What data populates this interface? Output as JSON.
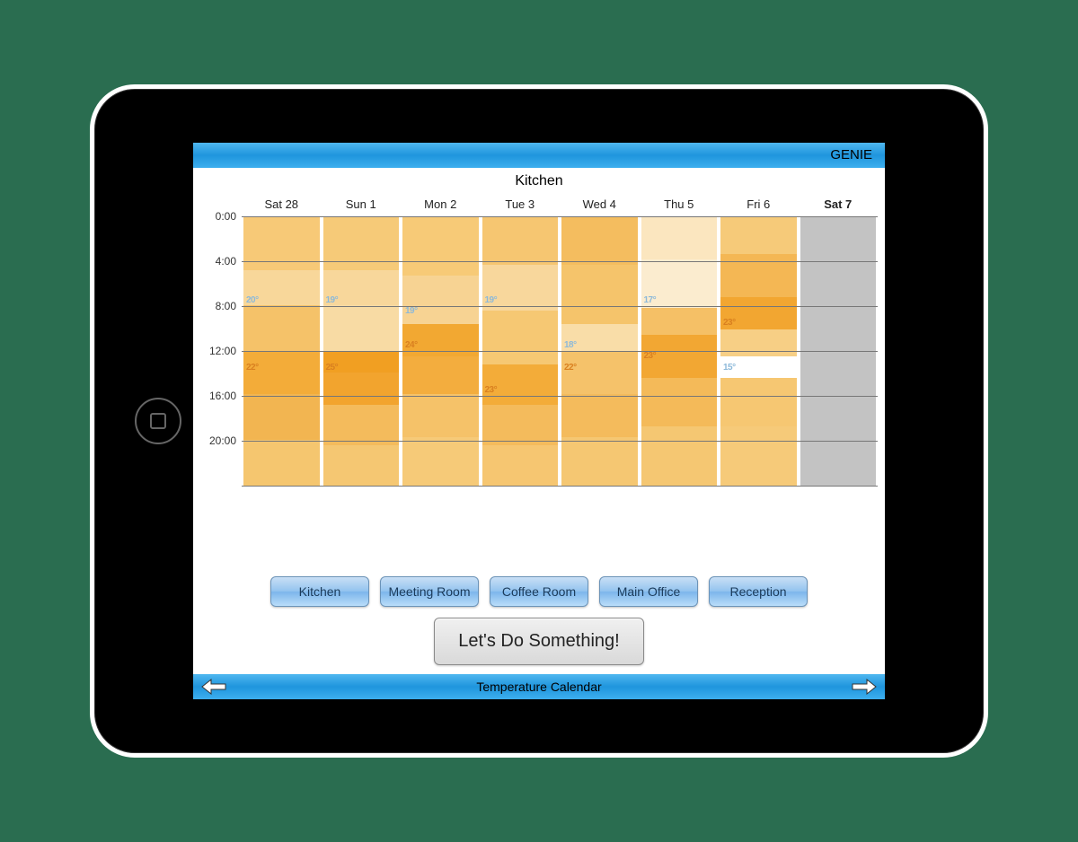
{
  "header": {
    "brand": "GENIE"
  },
  "page_title": "Kitchen",
  "footer": {
    "title": "Temperature Calendar"
  },
  "time_labels": [
    "0:00",
    "4:00",
    "8:00",
    "12:00",
    "16:00",
    "20:00"
  ],
  "days": [
    {
      "label": "Sat 28",
      "bold": false,
      "future": false
    },
    {
      "label": "Sun 1",
      "bold": false,
      "future": false
    },
    {
      "label": "Mon 2",
      "bold": false,
      "future": false
    },
    {
      "label": "Tue 3",
      "bold": false,
      "future": false
    },
    {
      "label": "Wed 4",
      "bold": false,
      "future": false
    },
    {
      "label": "Thu 5",
      "bold": false,
      "future": false
    },
    {
      "label": "Fri 6",
      "bold": false,
      "future": false
    },
    {
      "label": "Sat 7",
      "bold": true,
      "future": true
    }
  ],
  "annotations": [
    {
      "day": 0,
      "hour": 7,
      "text": "20°",
      "style": "cool"
    },
    {
      "day": 0,
      "hour": 13,
      "text": "22°",
      "style": "warm"
    },
    {
      "day": 1,
      "hour": 7,
      "text": "19°",
      "style": "cool"
    },
    {
      "day": 1,
      "hour": 13,
      "text": "25°",
      "style": "warm"
    },
    {
      "day": 2,
      "hour": 8,
      "text": "19°",
      "style": "cool"
    },
    {
      "day": 2,
      "hour": 11,
      "text": "24°",
      "style": "warm"
    },
    {
      "day": 3,
      "hour": 7,
      "text": "19°",
      "style": "cool"
    },
    {
      "day": 3,
      "hour": 15,
      "text": "23°",
      "style": "warm"
    },
    {
      "day": 4,
      "hour": 11,
      "text": "18°",
      "style": "cool"
    },
    {
      "day": 4,
      "hour": 13,
      "text": "22°",
      "style": "warm"
    },
    {
      "day": 5,
      "hour": 7,
      "text": "17°",
      "style": "cool"
    },
    {
      "day": 5,
      "hour": 12,
      "text": "23°",
      "style": "warm"
    },
    {
      "day": 6,
      "hour": 9,
      "text": "23°",
      "style": "warm"
    },
    {
      "day": 6,
      "hour": 13,
      "text": "15°",
      "style": "cool"
    }
  ],
  "room_buttons": [
    "Kitchen",
    "Meeting Room",
    "Coffee Room",
    "Main Office",
    "Reception"
  ],
  "cta": "Let's Do Something!",
  "chart_data": {
    "type": "heatmap",
    "title": "Kitchen",
    "xlabel": "",
    "ylabel": "",
    "x_categories": [
      "Sat 28",
      "Sun 1",
      "Mon 2",
      "Tue 3",
      "Wed 4",
      "Thu 5",
      "Fri 6",
      "Sat 7"
    ],
    "y_categories": [
      "0:00",
      "4:00",
      "8:00",
      "12:00",
      "16:00",
      "20:00"
    ],
    "value_unit": "°C",
    "series": {
      "Sat 28": {
        "0:00": 21,
        "4:00": 20,
        "8:00": 20,
        "12:00": 22,
        "16:00": 22,
        "20:00": 21
      },
      "Sun 1": {
        "0:00": 21,
        "4:00": 20,
        "8:00": 19,
        "12:00": 25,
        "16:00": 23,
        "20:00": 22
      },
      "Mon 2": {
        "0:00": 21,
        "4:00": 20,
        "8:00": 19,
        "12:00": 24,
        "16:00": 23,
        "20:00": 22
      },
      "Tue 3": {
        "0:00": 21,
        "4:00": 20,
        "8:00": 19,
        "12:00": 22,
        "16:00": 23,
        "20:00": 22
      },
      "Wed 4": {
        "0:00": 22,
        "4:00": 21,
        "8:00": 20,
        "12:00": 18,
        "16:00": 22,
        "20:00": 21
      },
      "Thu 5": {
        "0:00": 20,
        "4:00": 18,
        "8:00": 17,
        "12:00": 23,
        "16:00": 22,
        "20:00": 21
      },
      "Fri 6": {
        "0:00": 21,
        "4:00": 22,
        "8:00": 23,
        "12:00": 15,
        "16:00": 21,
        "20:00": 21
      },
      "Sat 7": null
    },
    "null_means": "future / no data"
  },
  "heat_bands": {
    "Sat 28": [
      [
        "#f7c977",
        0,
        20
      ],
      [
        "#f8d79a",
        20,
        33
      ],
      [
        "#f5c269",
        33,
        50
      ],
      [
        "#f3ac39",
        50,
        66
      ],
      [
        "#f2b551",
        66,
        83
      ],
      [
        "#f5c66f",
        83,
        100
      ]
    ],
    "Sun 1": [
      [
        "#f6ca78",
        0,
        20
      ],
      [
        "#f8d79b",
        20,
        33
      ],
      [
        "#f8dba4",
        33,
        50
      ],
      [
        "#f19f22",
        50,
        58
      ],
      [
        "#f2a42e",
        58,
        70
      ],
      [
        "#f4bb5c",
        70,
        85
      ],
      [
        "#f5c772",
        85,
        100
      ]
    ],
    "Mon 2": [
      [
        "#f7ca77",
        0,
        22
      ],
      [
        "#f7d393",
        22,
        40
      ],
      [
        "#f2a832",
        40,
        52
      ],
      [
        "#f3ad3e",
        52,
        66
      ],
      [
        "#f5c269",
        66,
        82
      ],
      [
        "#f6ca78",
        82,
        100
      ]
    ],
    "Tue 3": [
      [
        "#f6c671",
        0,
        18
      ],
      [
        "#f8d79c",
        18,
        35
      ],
      [
        "#f6c873",
        35,
        55
      ],
      [
        "#f3ac39",
        55,
        70
      ],
      [
        "#f4bb5c",
        70,
        85
      ],
      [
        "#f6c671",
        85,
        100
      ]
    ],
    "Wed 4": [
      [
        "#f4bd5f",
        0,
        18
      ],
      [
        "#f5c46b",
        18,
        40
      ],
      [
        "#f9dda8",
        40,
        50
      ],
      [
        "#f5c26a",
        50,
        66
      ],
      [
        "#f4bb5c",
        66,
        82
      ],
      [
        "#f5c772",
        82,
        100
      ]
    ],
    "Thu 5": [
      [
        "#fbe6bf",
        0,
        16
      ],
      [
        "#fbeccf",
        16,
        34
      ],
      [
        "#f5c066",
        34,
        44
      ],
      [
        "#f2a733",
        44,
        60
      ],
      [
        "#f4ba59",
        60,
        78
      ],
      [
        "#f5c772",
        78,
        100
      ]
    ],
    "Fri 6": [
      [
        "#f6ca79",
        0,
        14
      ],
      [
        "#f4b754",
        14,
        30
      ],
      [
        "#f2a631",
        30,
        42
      ],
      [
        "#f7cf85",
        42,
        52
      ],
      [
        "#ffffff",
        52,
        60
      ],
      [
        "#f6c772",
        60,
        78
      ],
      [
        "#f6ca79",
        78,
        100
      ]
    ]
  }
}
